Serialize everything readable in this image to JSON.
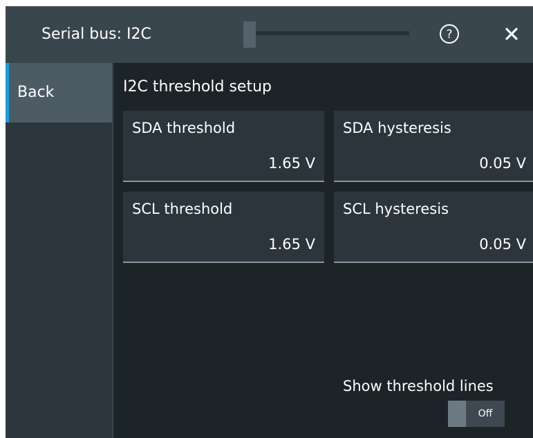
{
  "window": {
    "title": "Serial bus: I2C",
    "help_icon": "help-circle-icon",
    "close_icon": "close-x-icon"
  },
  "sidebar": {
    "back_label": "Back",
    "accent_color": "#1c9ee0"
  },
  "section": {
    "title": "I2C threshold setup"
  },
  "fields": {
    "sda_threshold": {
      "label": "SDA threshold",
      "value": "1.65 V"
    },
    "sda_hysteresis": {
      "label": "SDA hysteresis",
      "value": "0.05 V"
    },
    "scl_threshold": {
      "label": "SCL threshold",
      "value": "1.65 V"
    },
    "scl_hysteresis": {
      "label": "SCL hysteresis",
      "value": "0.05 V"
    }
  },
  "threshold_lines": {
    "label": "Show threshold lines",
    "state": "Off"
  }
}
